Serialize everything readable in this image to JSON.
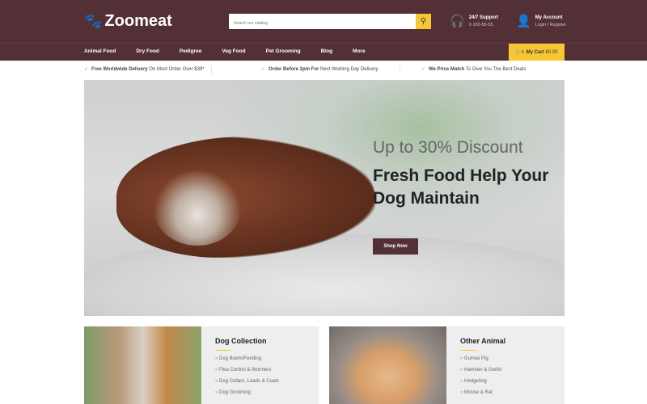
{
  "header": {
    "logo": "Zoomeat",
    "search_placeholder": "Search our catalog",
    "support": {
      "title": "24/7 Support",
      "phone": "2-100-56-55"
    },
    "account": {
      "title": "My Account",
      "links": "Login / Register"
    }
  },
  "nav": [
    "Animal Food",
    "Dry Food",
    "Pedigree",
    "Veg Food",
    "Pet Grooming",
    "Blog",
    "More"
  ],
  "cart": {
    "label": "My Cart",
    "total": "€0.00",
    "count": "0"
  },
  "usps": [
    {
      "bold": "Free Worldwide Delivery",
      "rest": " On Most Order Over $39*"
    },
    {
      "bold": "Order Before 2pm For",
      "rest": " Next Working Day Delivery"
    },
    {
      "bold": "We Price Match",
      "rest": " To Give You The Best Deals"
    }
  ],
  "hero": {
    "subtitle": "Up to 30% Discount",
    "title": "Fresh Food Help Your Dog Maintain",
    "button": "Shop Now"
  },
  "collections": [
    {
      "title": "Dog Collection",
      "items": [
        "Dog Bowls/Feeding",
        "Flea Control & Wormers",
        "Dog Collars, Leads & Coats",
        "Dog Grooming"
      ]
    },
    {
      "title": "Other Animal",
      "items": [
        "Guinea Pig",
        "Hamster & Gerbil",
        "Hedgehog",
        "Mouse & Rat"
      ]
    }
  ]
}
